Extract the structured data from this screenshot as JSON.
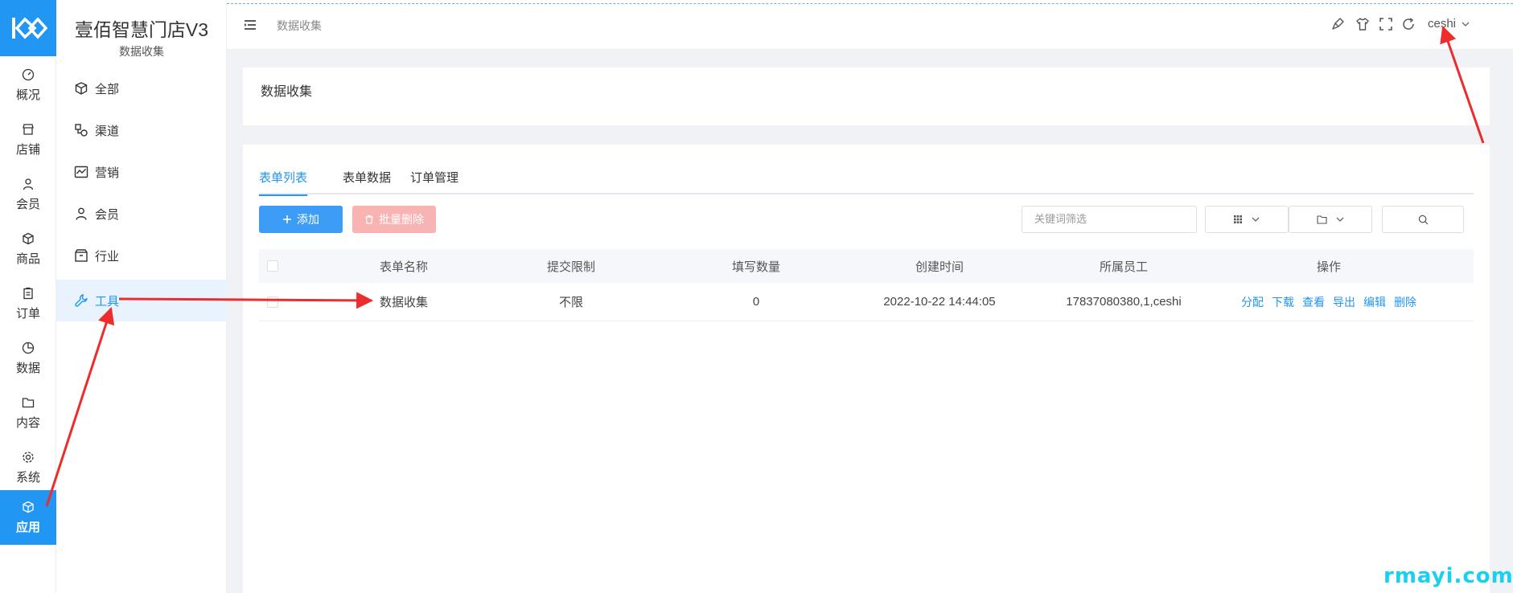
{
  "rail": {
    "items": [
      {
        "label": "概况",
        "icon": "dashboard-icon"
      },
      {
        "label": "店铺",
        "icon": "store-icon"
      },
      {
        "label": "会员",
        "icon": "user-icon"
      },
      {
        "label": "商品",
        "icon": "cube-icon"
      },
      {
        "label": "订单",
        "icon": "clipboard-icon"
      },
      {
        "label": "数据",
        "icon": "pie-chart-icon"
      },
      {
        "label": "内容",
        "icon": "folder-icon"
      },
      {
        "label": "系统",
        "icon": "gear-icon"
      },
      {
        "label": "应用",
        "icon": "app-cube-icon",
        "active": true
      }
    ]
  },
  "sidebar": {
    "title": "壹佰智慧门店V3",
    "subtitle": "数据收集",
    "items": [
      {
        "label": "全部",
        "icon": "cube-icon"
      },
      {
        "label": "渠道",
        "icon": "channel-icon"
      },
      {
        "label": "营销",
        "icon": "trend-chart-icon"
      },
      {
        "label": "会员",
        "icon": "user-icon"
      },
      {
        "label": "行业",
        "icon": "box-icon"
      },
      {
        "label": "工具",
        "icon": "wrench-icon",
        "active": true
      }
    ]
  },
  "header": {
    "breadcrumb": "数据收集",
    "username": "ceshi"
  },
  "page": {
    "card_title": "数据收集",
    "tabs": [
      "表单列表",
      "表单数据",
      "订单管理"
    ],
    "add_label": "添加",
    "bulk_delete_label": "批量删除",
    "search_placeholder": "关键词筛选"
  },
  "table": {
    "columns": [
      "表单名称",
      "提交限制",
      "填写数量",
      "创建时间",
      "所属员工",
      "操作"
    ],
    "rows": [
      {
        "name": "数据收集",
        "limit": "不限",
        "count": "0",
        "created": "2022-10-22 14:44:05",
        "staff": "17837080380,1,ceshi",
        "actions": [
          "分配",
          "下载",
          "查看",
          "导出",
          "编辑",
          "删除"
        ]
      }
    ]
  },
  "watermark": "rmayi.com",
  "colors": {
    "accent": "#2196f3",
    "danger_light": "#f8b3b3",
    "annotation": "#ee2c2c"
  }
}
